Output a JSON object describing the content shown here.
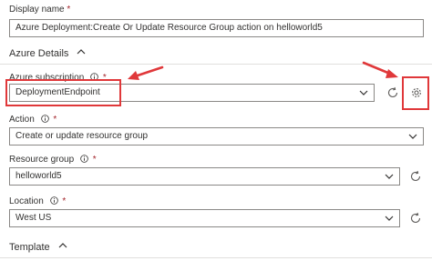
{
  "display_name": {
    "label": "Display name",
    "required_mark": "*",
    "value": "Azure Deployment:Create Or Update Resource Group action on helloworld5"
  },
  "azure_details": {
    "title": "Azure Details"
  },
  "subscription": {
    "label": "Azure subscription",
    "required_mark": "*",
    "value": "DeploymentEndpoint"
  },
  "action": {
    "label": "Action",
    "required_mark": "*",
    "value": "Create or update resource group"
  },
  "resource_group": {
    "label": "Resource group",
    "required_mark": "*",
    "value": "helloworld5"
  },
  "location": {
    "label": "Location",
    "required_mark": "*",
    "value": "West US"
  },
  "template": {
    "title": "Template"
  },
  "colors": {
    "annotation": "#e0383a",
    "border": "#8a8886",
    "text": "#323130",
    "required": "#a4262c"
  }
}
